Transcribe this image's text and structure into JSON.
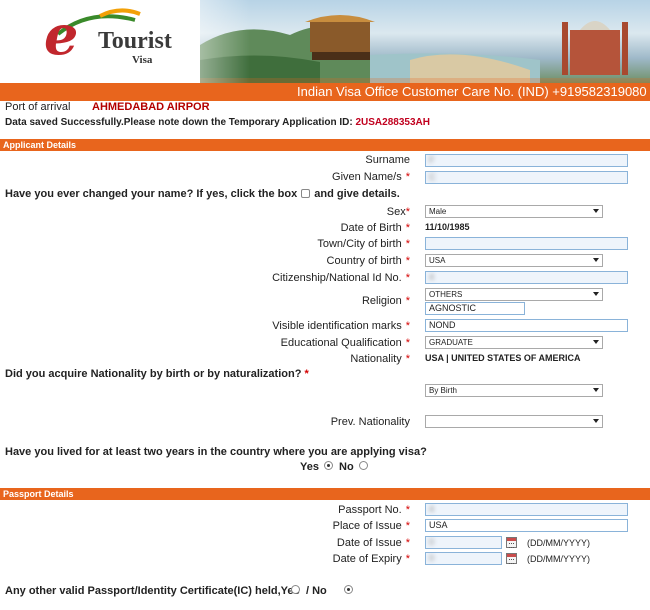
{
  "header": {
    "logo_letter": "e",
    "logo_word": "Tourist",
    "logo_sub": "Visa",
    "customer_care": "Indian Visa Office Customer Care No. (IND) +919582319080 / ("
  },
  "port": {
    "label": "Port of arrival",
    "value": "AHMEDABAD AIRPOR"
  },
  "saved": {
    "message": "Data saved Successfully.Please note down the Temporary Application ID: ",
    "application_id": "2USA288353AH"
  },
  "sections": {
    "applicant": "Applicant Details",
    "passport": "Passport Details"
  },
  "applicant": {
    "surname_label": "Surname",
    "surname_value": "F",
    "given_label": "Given Name/s",
    "given_value": "C",
    "changed_name_q": "Have you ever changed your name? If yes, click the box",
    "changed_name_q2": "and give details.",
    "sex_label": "Sex",
    "sex_value": "Male",
    "dob_label": "Date of Birth",
    "dob_value": "11/10/1985",
    "city_label": "Town/City of birth",
    "city_value": "",
    "country_label": "Country of birth",
    "country_value": "USA",
    "citizen_label": "Citizenship/National Id No.",
    "citizen_value": "4",
    "religion_label": "Religion",
    "religion_value": "OTHERS",
    "religion_other": "AGNOSTIC",
    "marks_label": "Visible identification marks",
    "marks_value": "NOND",
    "edu_label": "Educational Qualification",
    "edu_value": "GRADUATE",
    "nat_label": "Nationality",
    "nat_value": "USA | UNITED STATES OF AMERICA",
    "acquire_q": "Did you acquire Nationality by birth or by naturalization?",
    "acquire_value": "By Birth",
    "prev_nat_label": "Prev. Nationality",
    "prev_nat_value": "",
    "lived_q": "Have you lived for at least two years in the country where you are applying visa?",
    "yes": "Yes",
    "no": "No"
  },
  "passport": {
    "no_label": "Passport No.",
    "no_value": "4",
    "place_label": "Place of Issue",
    "place_value": "USA",
    "issue_label": "Date of Issue",
    "issue_value": "0",
    "expiry_label": "Date of Expiry",
    "expiry_value": "0",
    "date_format": "(DD/MM/YYYY)",
    "other_q": "Any other valid Passport/Identity Certificate(IC) held,Yes",
    "other_no": "/ No"
  },
  "required_mark": "*",
  "icons": [
    "calendar-icon",
    "dropdown-arrow-icon",
    "logo-swoosh-icon"
  ],
  "colors": {
    "accent": "#e8651d",
    "logo_red": "#c1272d",
    "required": "#d40000",
    "input_border": "#8ab3d9"
  }
}
